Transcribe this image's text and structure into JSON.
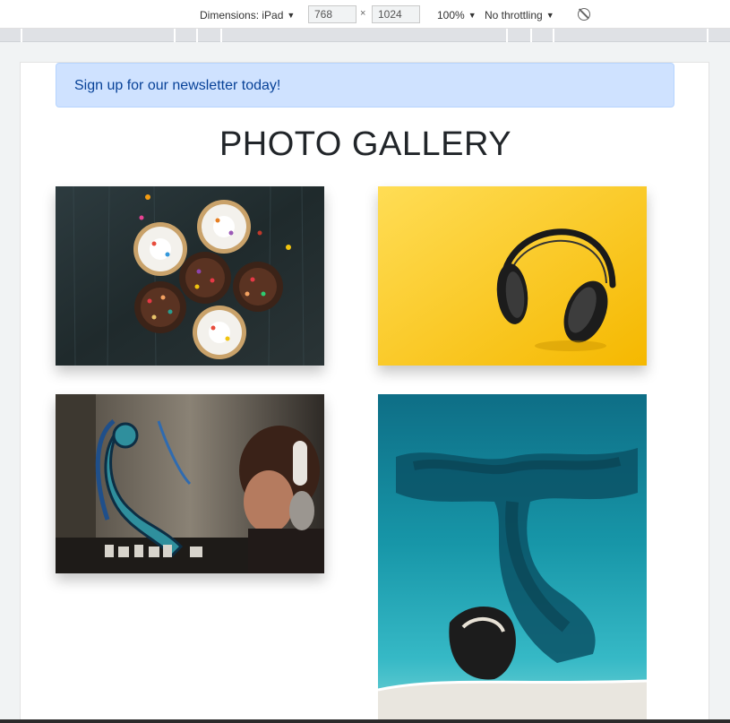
{
  "devtools": {
    "dimensions_label": "Dimensions: iPad",
    "width_value": "768",
    "height_value": "1024",
    "times": "×",
    "zoom": "100%",
    "throttling": "No throttling",
    "caret": "▼"
  },
  "page": {
    "alert_text": "Sign up for our newsletter today!",
    "title": "PHOTO GALLERY"
  }
}
